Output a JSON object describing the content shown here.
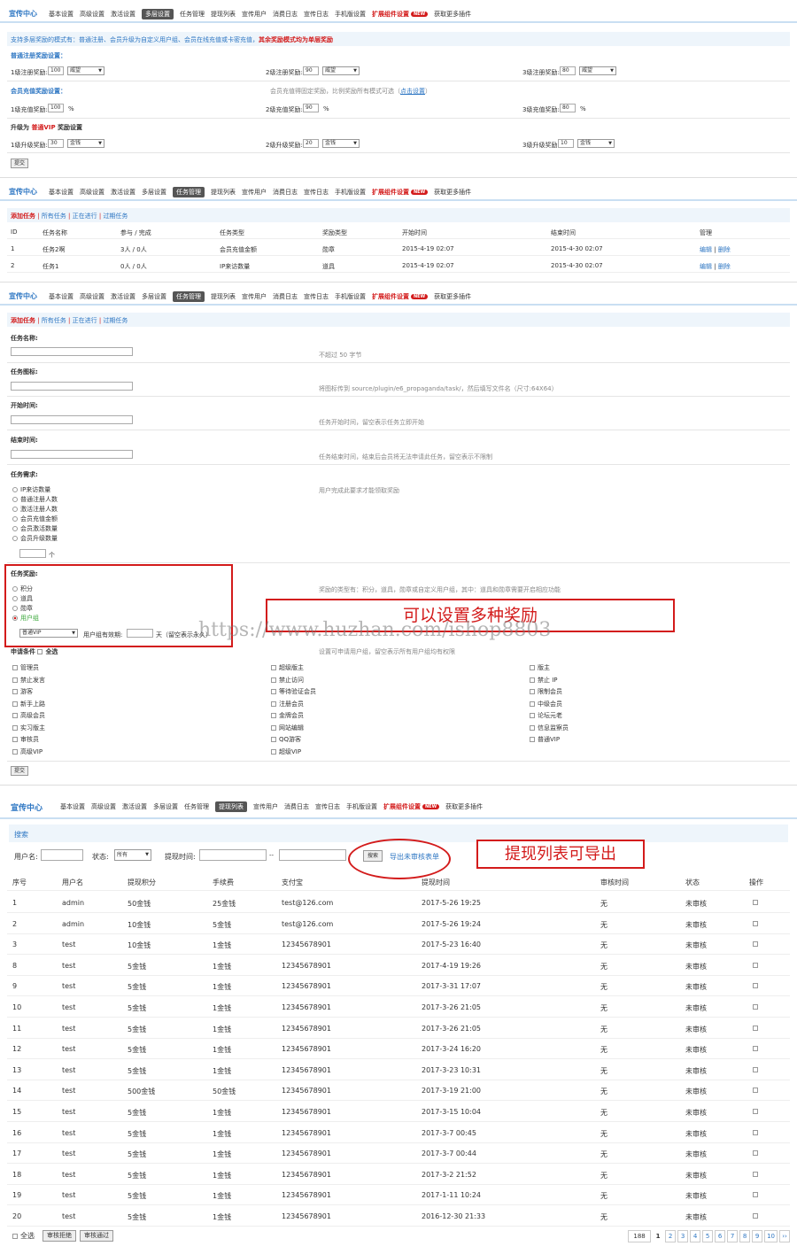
{
  "panels": {
    "p1": {
      "brand": "宣传中心",
      "tabs": [
        "基本设置",
        "高级设置",
        "激活设置",
        "多层设置",
        "任务管理",
        "提现列表",
        "宣传用户",
        "消费日志",
        "宣传日志",
        "手机版设置",
        "扩展组件设置",
        "获取更多插件"
      ],
      "active_tab": "多层设置",
      "info_prefix": "支持多层奖励的模式有：普通注册、会员升级为自定义用户组、会员在线充值或卡密充值，",
      "info_red": "其余奖励模式均为单层奖励",
      "reg_title": "普通注册奖励设置：",
      "reg_labels": [
        "1级注册奖励:",
        "2级注册奖励:",
        "3级注册奖励:"
      ],
      "reg_values": [
        "100",
        "90",
        "80"
      ],
      "reg_unit": "威望",
      "pay_title": "会员充值奖励设置：",
      "pay_note": "会员充值得固定奖励，比例奖励所有模式可选（",
      "pay_note_link": "点击设置",
      "pay_note_end": "）",
      "pay_labels": [
        "1级充值奖励:",
        "2级充值奖励:",
        "3级充值奖励:"
      ],
      "pay_values": [
        "100",
        "90",
        "80"
      ],
      "pay_unit": "%",
      "upg_title_prefix": "升级为",
      "upg_title_red": "普通VIP",
      "upg_title_suffix": "奖励设置",
      "upg_labels": [
        "1级升级奖励:",
        "2级升级奖励:",
        "3级升级奖励:"
      ],
      "upg_values": [
        "30",
        "20",
        "10"
      ],
      "upg_unit": "金钱",
      "submit": "提交"
    },
    "p2": {
      "brand": "宣传中心",
      "tabs": [
        "基本设置",
        "高级设置",
        "激活设置",
        "多层设置",
        "任务管理",
        "提现列表",
        "宣传用户",
        "消费日志",
        "宣传日志",
        "手机版设置",
        "扩展组件设置",
        "获取更多插件"
      ],
      "active_tab": "任务管理",
      "subnav": [
        "添加任务",
        "所有任务",
        "正在进行",
        "过期任务"
      ],
      "headers": [
        "ID",
        "任务名称",
        "参与 / 完成",
        "任务类型",
        "奖励类型",
        "开始时间",
        "结束时间",
        "管理"
      ],
      "rows": [
        [
          "1",
          "任务2啊",
          "3人 / 0人",
          "会员充值金额",
          "勋章",
          "2015-4-19 02:07",
          "2015-4-30 02:07"
        ],
        [
          "2",
          "任务1",
          "0人 / 0人",
          "IP来访数量",
          "道具",
          "2015-4-19 02:07",
          "2015-4-30 02:07"
        ]
      ],
      "manage_edit": "编辑",
      "manage_del": "删除"
    },
    "p3": {
      "brand": "宣传中心",
      "tabs": [
        "基本设置",
        "高级设置",
        "激活设置",
        "多层设置",
        "任务管理",
        "提现列表",
        "宣传用户",
        "消费日志",
        "宣传日志",
        "手机版设置",
        "扩展组件设置",
        "获取更多插件"
      ],
      "active_tab": "任务管理",
      "subnav": [
        "添加任务",
        "所有任务",
        "正在进行",
        "过期任务"
      ],
      "name_label": "任务名称:",
      "name_hint": "不超过 50 字节",
      "icon_label": "任务图标:",
      "icon_hint": "将图标传到 source/plugin/e6_propaganda/task/，然后填写文件名（尺寸:64X64）",
      "start_label": "开始时间:",
      "start_hint": "任务开始时间，留空表示任务立即开始",
      "end_label": "结束时间:",
      "end_hint": "任务结束时间，结束后会员将无法申请此任务，留空表示不限制",
      "req_label": "任务需求:",
      "req_hint": "用户完成此要求才能领取奖励",
      "req_options": [
        "IP来访数量",
        "普通注册人数",
        "激活注册人数",
        "会员充值金额",
        "会员激活数量",
        "会员升级数量"
      ],
      "req_unit": "个",
      "reward_label": "任务奖励:",
      "reward_hint": "奖励的类型有：积分，道具，勋章或自定义用户组，其中：道具和勋章需要开启相应功能",
      "reward_options": [
        "积分",
        "道具",
        "勋章",
        "用户组"
      ],
      "reward_selected": "用户组",
      "group_select": "普通VIP",
      "group_valid_label": "用户组有效期:",
      "group_valid_suffix": "天（留空表示永久）",
      "apply_label": "申请条件",
      "apply_all": "全选",
      "apply_hint": "设置可申请用户组，留空表示所有用户组均有权限",
      "groups_col1": [
        "管理员",
        "禁止发言",
        "游客",
        "新手上路",
        "高级会员",
        "实习版主",
        "审核员",
        "高级VIP"
      ],
      "groups_col2": [
        "超级版主",
        "禁止访问",
        "等待验证会员",
        "注册会员",
        "金牌会员",
        "网站编辑",
        "QQ游客",
        "超级VIP"
      ],
      "groups_col3": [
        "版主",
        "禁止 IP",
        "限制会员",
        "中级会员",
        "论坛元老",
        "信息监察员",
        "普通VIP"
      ],
      "submit": "提交",
      "callout": "可以设置多种奖励"
    },
    "p4": {
      "brand": "宣传中心",
      "tabs": [
        "基本设置",
        "高级设置",
        "激活设置",
        "多层设置",
        "任务管理",
        "提现列表",
        "宣传用户",
        "消费日志",
        "宣传日志",
        "手机版设置",
        "扩展组件设置",
        "获取更多插件"
      ],
      "active_tab": "提现列表",
      "search_title": "搜索",
      "username_label": "用户名:",
      "status_label": "状态:",
      "status_value": "所有",
      "time_label": "提现时间:",
      "time_sep": "--",
      "search_btn": "搜索",
      "export_link": "导出未审核表单",
      "callout": "提现列表可导出",
      "headers": [
        "序号",
        "用户名",
        "提现积分",
        "手续费",
        "支付宝",
        "提现时间",
        "审核时间",
        "状态",
        "操作"
      ],
      "rows": [
        [
          "1",
          "admin",
          "50金钱",
          "25金钱",
          "test@126.com",
          "2017-5-26 19:25",
          "无",
          "未审核"
        ],
        [
          "2",
          "admin",
          "10金钱",
          "5金钱",
          "test@126.com",
          "2017-5-26 19:24",
          "无",
          "未审核"
        ],
        [
          "3",
          "test",
          "10金钱",
          "1金钱",
          "12345678901",
          "2017-5-23 16:40",
          "无",
          "未审核"
        ],
        [
          "8",
          "test",
          "5金钱",
          "1金钱",
          "12345678901",
          "2017-4-19 19:26",
          "无",
          "未审核"
        ],
        [
          "9",
          "test",
          "5金钱",
          "1金钱",
          "12345678901",
          "2017-3-31 17:07",
          "无",
          "未审核"
        ],
        [
          "10",
          "test",
          "5金钱",
          "1金钱",
          "12345678901",
          "2017-3-26 21:05",
          "无",
          "未审核"
        ],
        [
          "11",
          "test",
          "5金钱",
          "1金钱",
          "12345678901",
          "2017-3-26 21:05",
          "无",
          "未审核"
        ],
        [
          "12",
          "test",
          "5金钱",
          "1金钱",
          "12345678901",
          "2017-3-24 16:20",
          "无",
          "未审核"
        ],
        [
          "13",
          "test",
          "5金钱",
          "1金钱",
          "12345678901",
          "2017-3-23 10:31",
          "无",
          "未审核"
        ],
        [
          "14",
          "test",
          "500金钱",
          "50金钱",
          "12345678901",
          "2017-3-19 21:00",
          "无",
          "未审核"
        ],
        [
          "15",
          "test",
          "5金钱",
          "1金钱",
          "12345678901",
          "2017-3-15 10:04",
          "无",
          "未审核"
        ],
        [
          "16",
          "test",
          "5金钱",
          "1金钱",
          "12345678901",
          "2017-3-7 00:45",
          "无",
          "未审核"
        ],
        [
          "17",
          "test",
          "5金钱",
          "1金钱",
          "12345678901",
          "2017-3-7 00:44",
          "无",
          "未审核"
        ],
        [
          "18",
          "test",
          "5金钱",
          "1金钱",
          "12345678901",
          "2017-3-2 21:52",
          "无",
          "未审核"
        ],
        [
          "19",
          "test",
          "5金钱",
          "1金钱",
          "12345678901",
          "2017-1-11 10:24",
          "无",
          "未审核"
        ],
        [
          "20",
          "test",
          "5金钱",
          "1金钱",
          "12345678901",
          "2016-12-30 21:33",
          "无",
          "未审核"
        ]
      ],
      "select_all": "全选",
      "reject_btn": "审核拒绝",
      "approve_btn": "审核通过",
      "pager": [
        "188",
        "1",
        "2",
        "3",
        "4",
        "5",
        "6",
        "7",
        "8",
        "9",
        "10",
        "››"
      ]
    }
  },
  "watermark": "https://www.huzhan.com/ishop8803"
}
